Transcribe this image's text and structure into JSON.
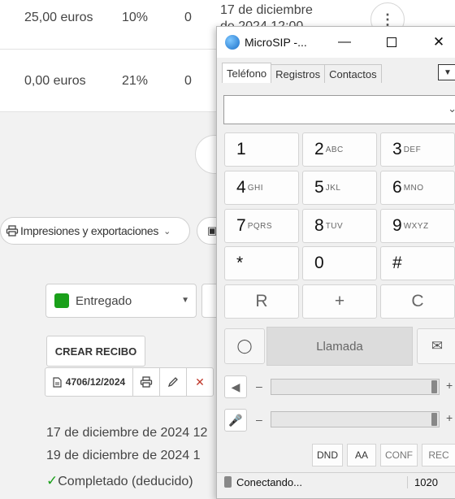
{
  "bg": {
    "row1": {
      "amount": "25,00 euros",
      "tax": "10%",
      "qty": "0",
      "date_line1": "17 de diciembre",
      "date_line2": "de 2024 12:00"
    },
    "row2": {
      "amount": "0,00 euros",
      "tax": "21%",
      "qty": "0"
    },
    "more_icon": "⋮",
    "exports_label": "Impresiones y exportaciones",
    "status_select": "Entregado",
    "crear_recibo": "CREAR RECIBO",
    "doc_number": "4706/12/2024",
    "date1": "17 de diciembre de 2024 12",
    "date2": "19 de diciembre de 2024 1",
    "completed": "Completado (deducido)",
    "colors": {
      "entregado": "#1aa01a",
      "check": "#1aa01a",
      "delete": "#c0392b"
    }
  },
  "microsip": {
    "title": "MicroSIP -...",
    "tabs": [
      "Teléfono",
      "Registros",
      "Contactos"
    ],
    "keys": [
      {
        "d": "1",
        "s": ""
      },
      {
        "d": "2",
        "s": "ABC"
      },
      {
        "d": "3",
        "s": "DEF"
      },
      {
        "d": "4",
        "s": "GHI"
      },
      {
        "d": "5",
        "s": "JKL"
      },
      {
        "d": "6",
        "s": "MNO"
      },
      {
        "d": "7",
        "s": "PQRS"
      },
      {
        "d": "8",
        "s": "TUV"
      },
      {
        "d": "9",
        "s": "WXYZ"
      },
      {
        "d": "*",
        "s": ""
      },
      {
        "d": "0",
        "s": ""
      },
      {
        "d": "#",
        "s": ""
      }
    ],
    "keys_bottom": [
      "R",
      "+",
      "C"
    ],
    "call_label": "Llamada",
    "minus": "–",
    "plus": "+",
    "buttons": [
      "DND",
      "AA",
      "CONF",
      "REC"
    ],
    "status": "Conectando...",
    "port": "1020",
    "icons": [
      "microsip-app-icon",
      "minimize-icon",
      "maximize-icon",
      "close-icon",
      "dropdown-icon",
      "voicemail-icon",
      "message-icon",
      "speaker-icon",
      "microphone-icon",
      "status-icon"
    ]
  }
}
